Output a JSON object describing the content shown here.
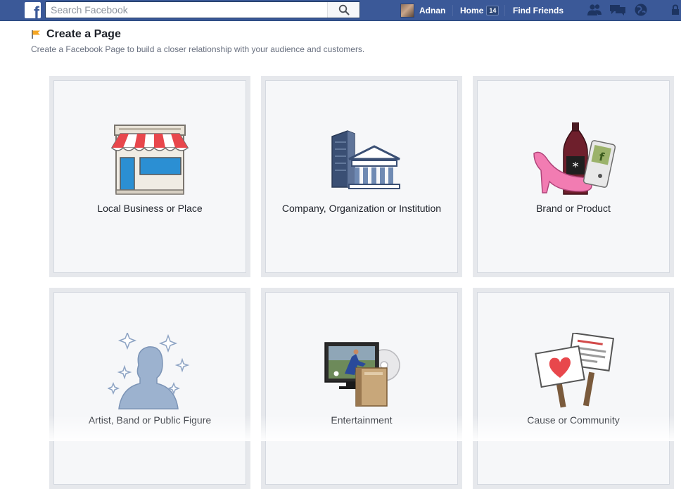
{
  "topbar": {
    "logo_letter": "f",
    "search_placeholder": "Search Facebook",
    "user_name": "Adnan",
    "home_label": "Home",
    "home_badge": "14",
    "find_friends_label": "Find Friends"
  },
  "header": {
    "title": "Create a Page",
    "subtitle": "Create a Facebook Page to build a closer relationship with your audience and customers."
  },
  "categories": [
    {
      "label": "Local Business or Place",
      "icon": "storefront-icon"
    },
    {
      "label": "Company, Organization or Institution",
      "icon": "office-building-icon"
    },
    {
      "label": "Brand or Product",
      "icon": "products-icon"
    },
    {
      "label": "Artist, Band or Public Figure",
      "icon": "person-silhouette-icon"
    },
    {
      "label": "Entertainment",
      "icon": "tv-film-icon"
    },
    {
      "label": "Cause or Community",
      "icon": "protest-signs-icon"
    }
  ],
  "colors": {
    "brand_blue": "#3b5998",
    "card_bg": "#f6f7f9",
    "card_border": "#e6e8ec"
  }
}
